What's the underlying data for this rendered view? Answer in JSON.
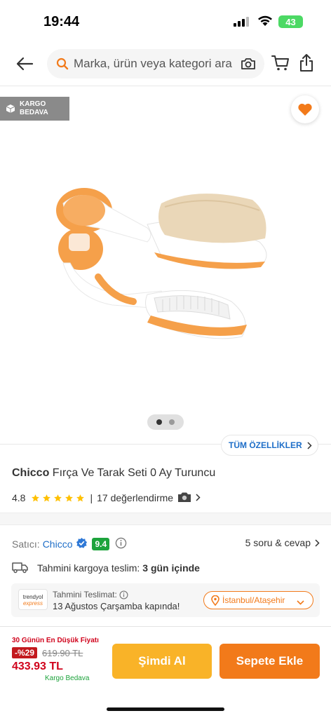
{
  "status_bar": {
    "time": "19:44",
    "battery": "43"
  },
  "header": {
    "search_placeholder": "Marka, ürün veya kategori ara"
  },
  "gallery": {
    "cargo_badge_line1": "KARGO",
    "cargo_badge_line2": "BEDAVA",
    "image_alt": "Chicco Fırça Ve Tarak Seti 0 Ay Turuncu",
    "image_count": 2,
    "active_index": 0,
    "all_features_label": "TÜM ÖZELLİKLER"
  },
  "product": {
    "brand": "Chicco",
    "name": "Fırça Ve Tarak Seti 0 Ay Turuncu",
    "rating": "4.8",
    "stars": 5,
    "separator": "|",
    "review_count": "17 değerlendirme"
  },
  "seller": {
    "label": "Satıcı:",
    "name": "Chicco",
    "score": "9.4",
    "qa_label": "5 soru & cevap"
  },
  "shipping": {
    "label": "Tahmini kargoya teslim:",
    "value": "3 gün içinde"
  },
  "delivery": {
    "logo_line1": "trendyol",
    "logo_line2": "express",
    "label": "Tahmini Teslimat:",
    "date": "13 Ağustos Çarşamba kapında!",
    "location": "İstanbul/Ataşehir"
  },
  "price": {
    "lowest_label": "30 Günün En Düşük Fiyatı",
    "discount": "-%29",
    "old_price": "619.90 TL",
    "current_price": "433.93 TL",
    "free_shipping": "Kargo Bedava"
  },
  "actions": {
    "buy_now": "Şimdi Al",
    "add_to_cart": "Sepete Ekle"
  },
  "colors": {
    "accent": "#f27a1a",
    "buy_now": "#f9b328",
    "link": "#1e6ec8",
    "discount": "#c3191e",
    "score": "#1da33c"
  }
}
